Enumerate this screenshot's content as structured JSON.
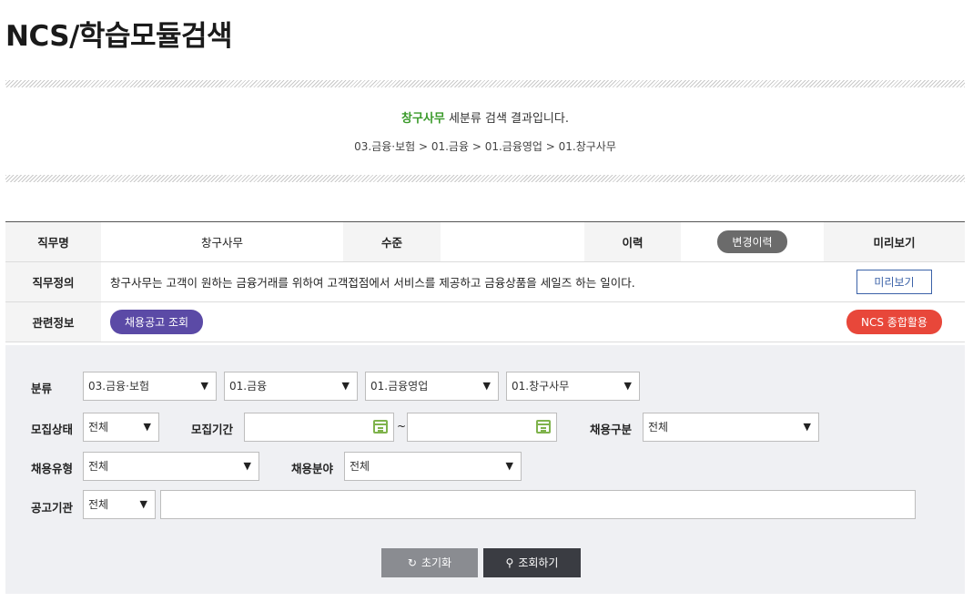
{
  "page": {
    "title": "NCS/학습모듈검색"
  },
  "result": {
    "highlight": "창구사무",
    "suffix": " 세분류 검색 결과입니다.",
    "path": "03.금융·보험 > 01.금융 > 01.금융영업 > 01.창구사무"
  },
  "info": {
    "job_name_label": "직무명",
    "job_name_value": "창구사무",
    "level_label": "수준",
    "level_value": "",
    "history_label": "이력",
    "history_button": "변경이력",
    "preview_header": "미리보기",
    "definition_label": "직무정의",
    "definition_value": "창구사무는 고객이 원하는 금융거래를 위하여 고객접점에서 서비스를 제공하고 금융상품을 세일즈 하는 일이다.",
    "preview_button": "미리보기",
    "related_label": "관련정보",
    "recruit_button": "채용공고 조회",
    "ncs_button": "NCS 종합활용"
  },
  "search": {
    "category_label": "분류",
    "category_selects": [
      "03.금융·보험",
      "01.금융",
      "01.금융영업",
      "01.창구사무"
    ],
    "status_label": "모집상태",
    "status_value": "전체",
    "period_label": "모집기간",
    "period_tilde": "~",
    "hire_type_label": "채용구분",
    "hire_type_value": "전체",
    "employment_type_label": "채용유형",
    "employment_type_value": "전체",
    "field_label": "채용분야",
    "field_value": "전체",
    "agency_label": "공고기관",
    "agency_value": "전체",
    "agency_input": "",
    "reset_button": "초기화",
    "search_button": "조회하기",
    "arrow": "▼"
  },
  "icons": {
    "reset": "refresh-icon",
    "search": "search-icon",
    "calendar": "calendar-icon"
  }
}
